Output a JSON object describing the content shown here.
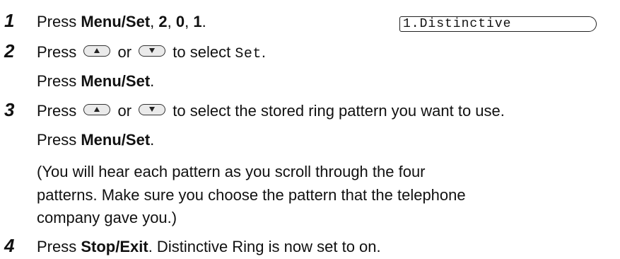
{
  "lcd": {
    "text": "1.Distinctive"
  },
  "steps": [
    {
      "number": "1",
      "line1": {
        "prefix": "Press ",
        "keys": "Menu/Set",
        "sep1": ", ",
        "k2": "2",
        "sep2": ", ",
        "k3": "0",
        "sep3": ", ",
        "k4": "1",
        "suffix": "."
      }
    },
    {
      "number": "2",
      "line1": {
        "prefix": "Press ",
        "or": " or ",
        "mid": " to select ",
        "value": "Set",
        "suffix": "."
      },
      "line2": {
        "prefix": "Press ",
        "key": "Menu/Set",
        "suffix": "."
      }
    },
    {
      "number": "3",
      "line1": {
        "prefix": "Press ",
        "or": " or ",
        "suffix": " to select the stored ring pattern you want to use."
      },
      "line2": {
        "prefix": "Press ",
        "key": "Menu/Set",
        "suffix": "."
      },
      "note": [
        "(You will hear each pattern as you scroll through the four",
        "patterns. Make sure you choose the pattern that the telephone",
        "company gave you.)"
      ]
    },
    {
      "number": "4",
      "line1": {
        "prefix": "Press ",
        "key": "Stop/Exit",
        "suffix": ". Distinctive Ring is now set to on."
      }
    }
  ],
  "icons": {
    "up": "up-arrow-key-icon",
    "down": "down-arrow-key-icon"
  }
}
